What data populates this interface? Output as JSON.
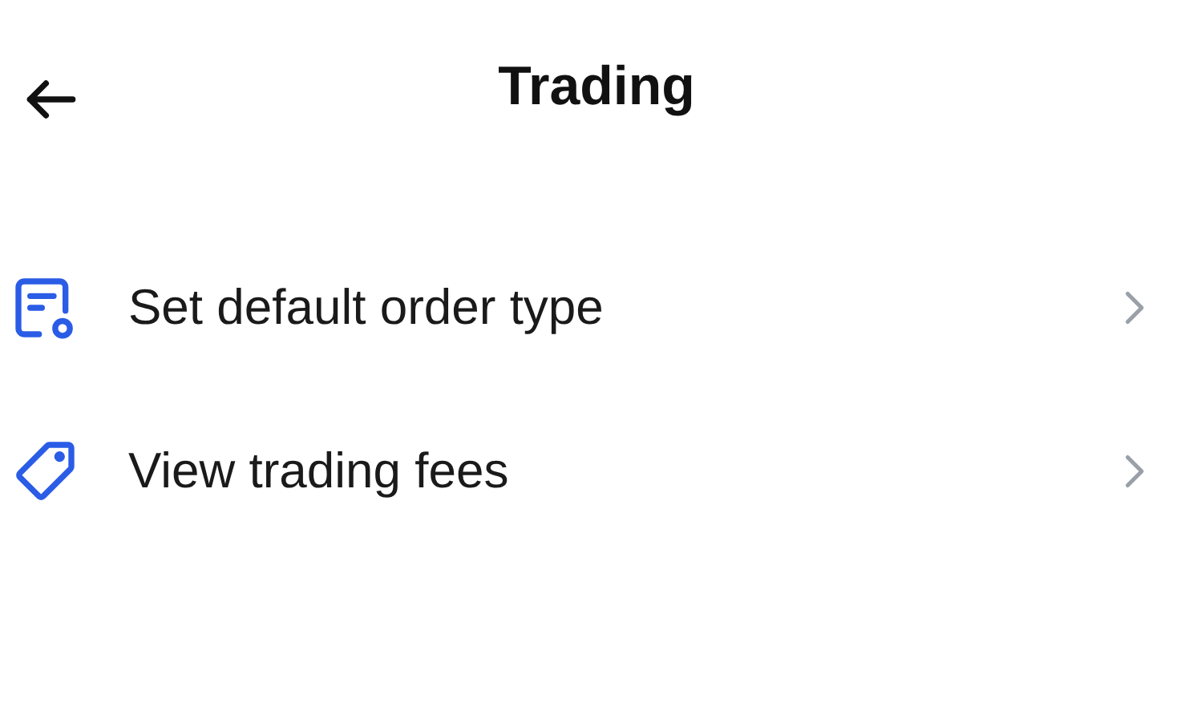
{
  "header": {
    "title": "Trading"
  },
  "items": [
    {
      "label": "Set default order type",
      "kind": "order"
    },
    {
      "label": "View trading fees",
      "kind": "tag"
    }
  ]
}
